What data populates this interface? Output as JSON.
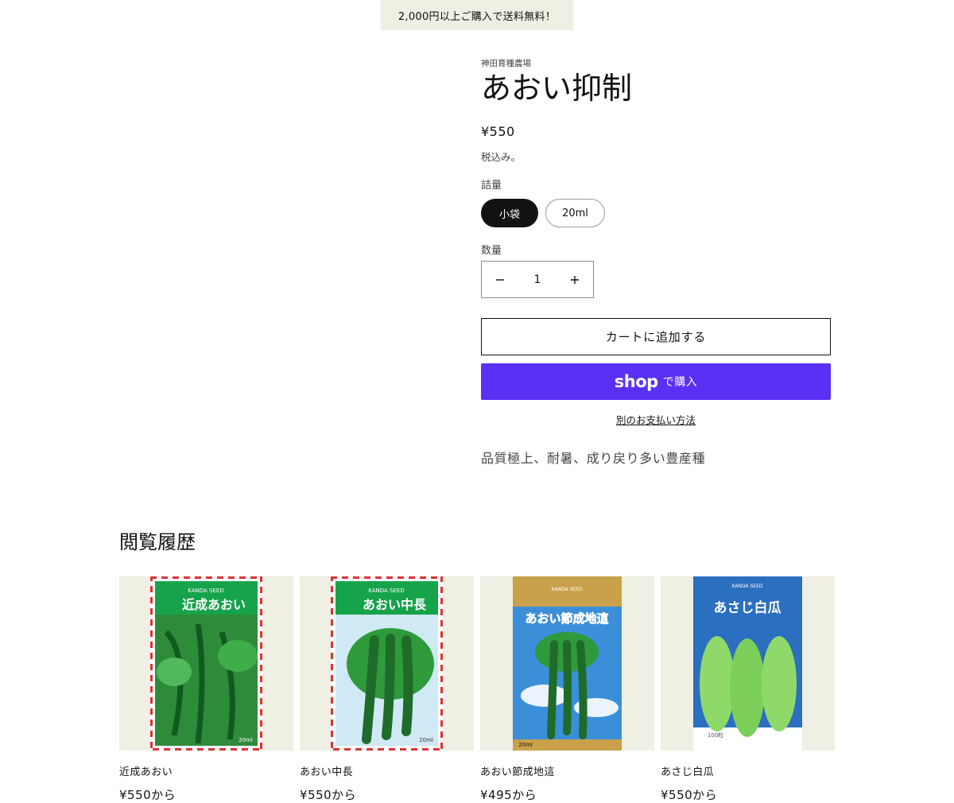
{
  "announcement": "2,000円以上ご購入で送料無料！",
  "product": {
    "vendor": "神田育種農場",
    "title": "あおい抑制",
    "price": "¥550",
    "tax_note": "税込み。",
    "option_label": "詰量",
    "options": [
      "小袋",
      "20ml"
    ],
    "selected_option": "小袋",
    "quantity_label": "数量",
    "quantity": "1",
    "add_to_cart": "カートに追加する",
    "shop_pay_logo": "shop",
    "shop_pay_label": "で購入",
    "alt_payment": "別のお支払い方法",
    "description": "品質極上、耐暑、成り戻り多い豊産種"
  },
  "recently_viewed": {
    "title": "閲覧履歴",
    "items": [
      {
        "name": "近成あおい",
        "price": "¥550から",
        "packet_text": "近成あおい",
        "packet_brand": "KANDA SEED",
        "packet_volume": "20ml"
      },
      {
        "name": "あおい中長",
        "price": "¥550から",
        "packet_text": "あおい中長",
        "packet_brand": "KANDA SEED",
        "packet_volume": "20ml"
      },
      {
        "name": "あおい節成地這",
        "price": "¥495から",
        "packet_text": "あおい節成地這",
        "packet_brand": "KANDA SEED",
        "packet_volume": "20ml"
      },
      {
        "name": "あさじ白瓜",
        "price": "¥550から",
        "packet_text": "あさじ白瓜",
        "packet_brand": "KANDA SEED",
        "packet_volume": "100粒"
      }
    ]
  },
  "colors": {
    "shop_pay": "#5a31f4",
    "announcement_bg": "#efefe3",
    "selected_pill": "#121212"
  }
}
